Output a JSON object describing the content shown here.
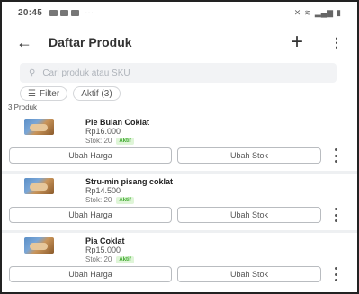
{
  "status_bar": {
    "time": "20:45",
    "dots": "···"
  },
  "app_bar": {
    "title": "Daftar Produk",
    "back_icon": "arrow-left-icon",
    "add_icon": "plus-icon",
    "more_icon": "kebab-icon"
  },
  "search": {
    "placeholder": "Cari produk atau SKU"
  },
  "filters": {
    "filter_label": "Filter",
    "status_label": "Aktif (3)"
  },
  "product_count": "3 Produk",
  "products": [
    {
      "name": "Pie Bulan Coklat",
      "price": "Rp16.000",
      "stock": "Stok: 20",
      "status": "Aktif",
      "edit_price_label": "Ubah Harga",
      "edit_stock_label": "Ubah Stok"
    },
    {
      "name": "Stru-min pisang coklat",
      "price": "Rp14.500",
      "stock": "Stok: 20",
      "status": "Aktif",
      "edit_price_label": "Ubah Harga",
      "edit_stock_label": "Ubah Stok"
    },
    {
      "name": "Pia Coklat",
      "price": "Rp15.000",
      "stock": "Stok: 20",
      "status": "Aktif",
      "edit_price_label": "Ubah Harga",
      "edit_stock_label": "Ubah Stok"
    }
  ],
  "colors": {
    "active_badge_bg": "#dff5d8",
    "active_badge_text": "#3aa82a",
    "search_bg": "#f2f3f5"
  }
}
